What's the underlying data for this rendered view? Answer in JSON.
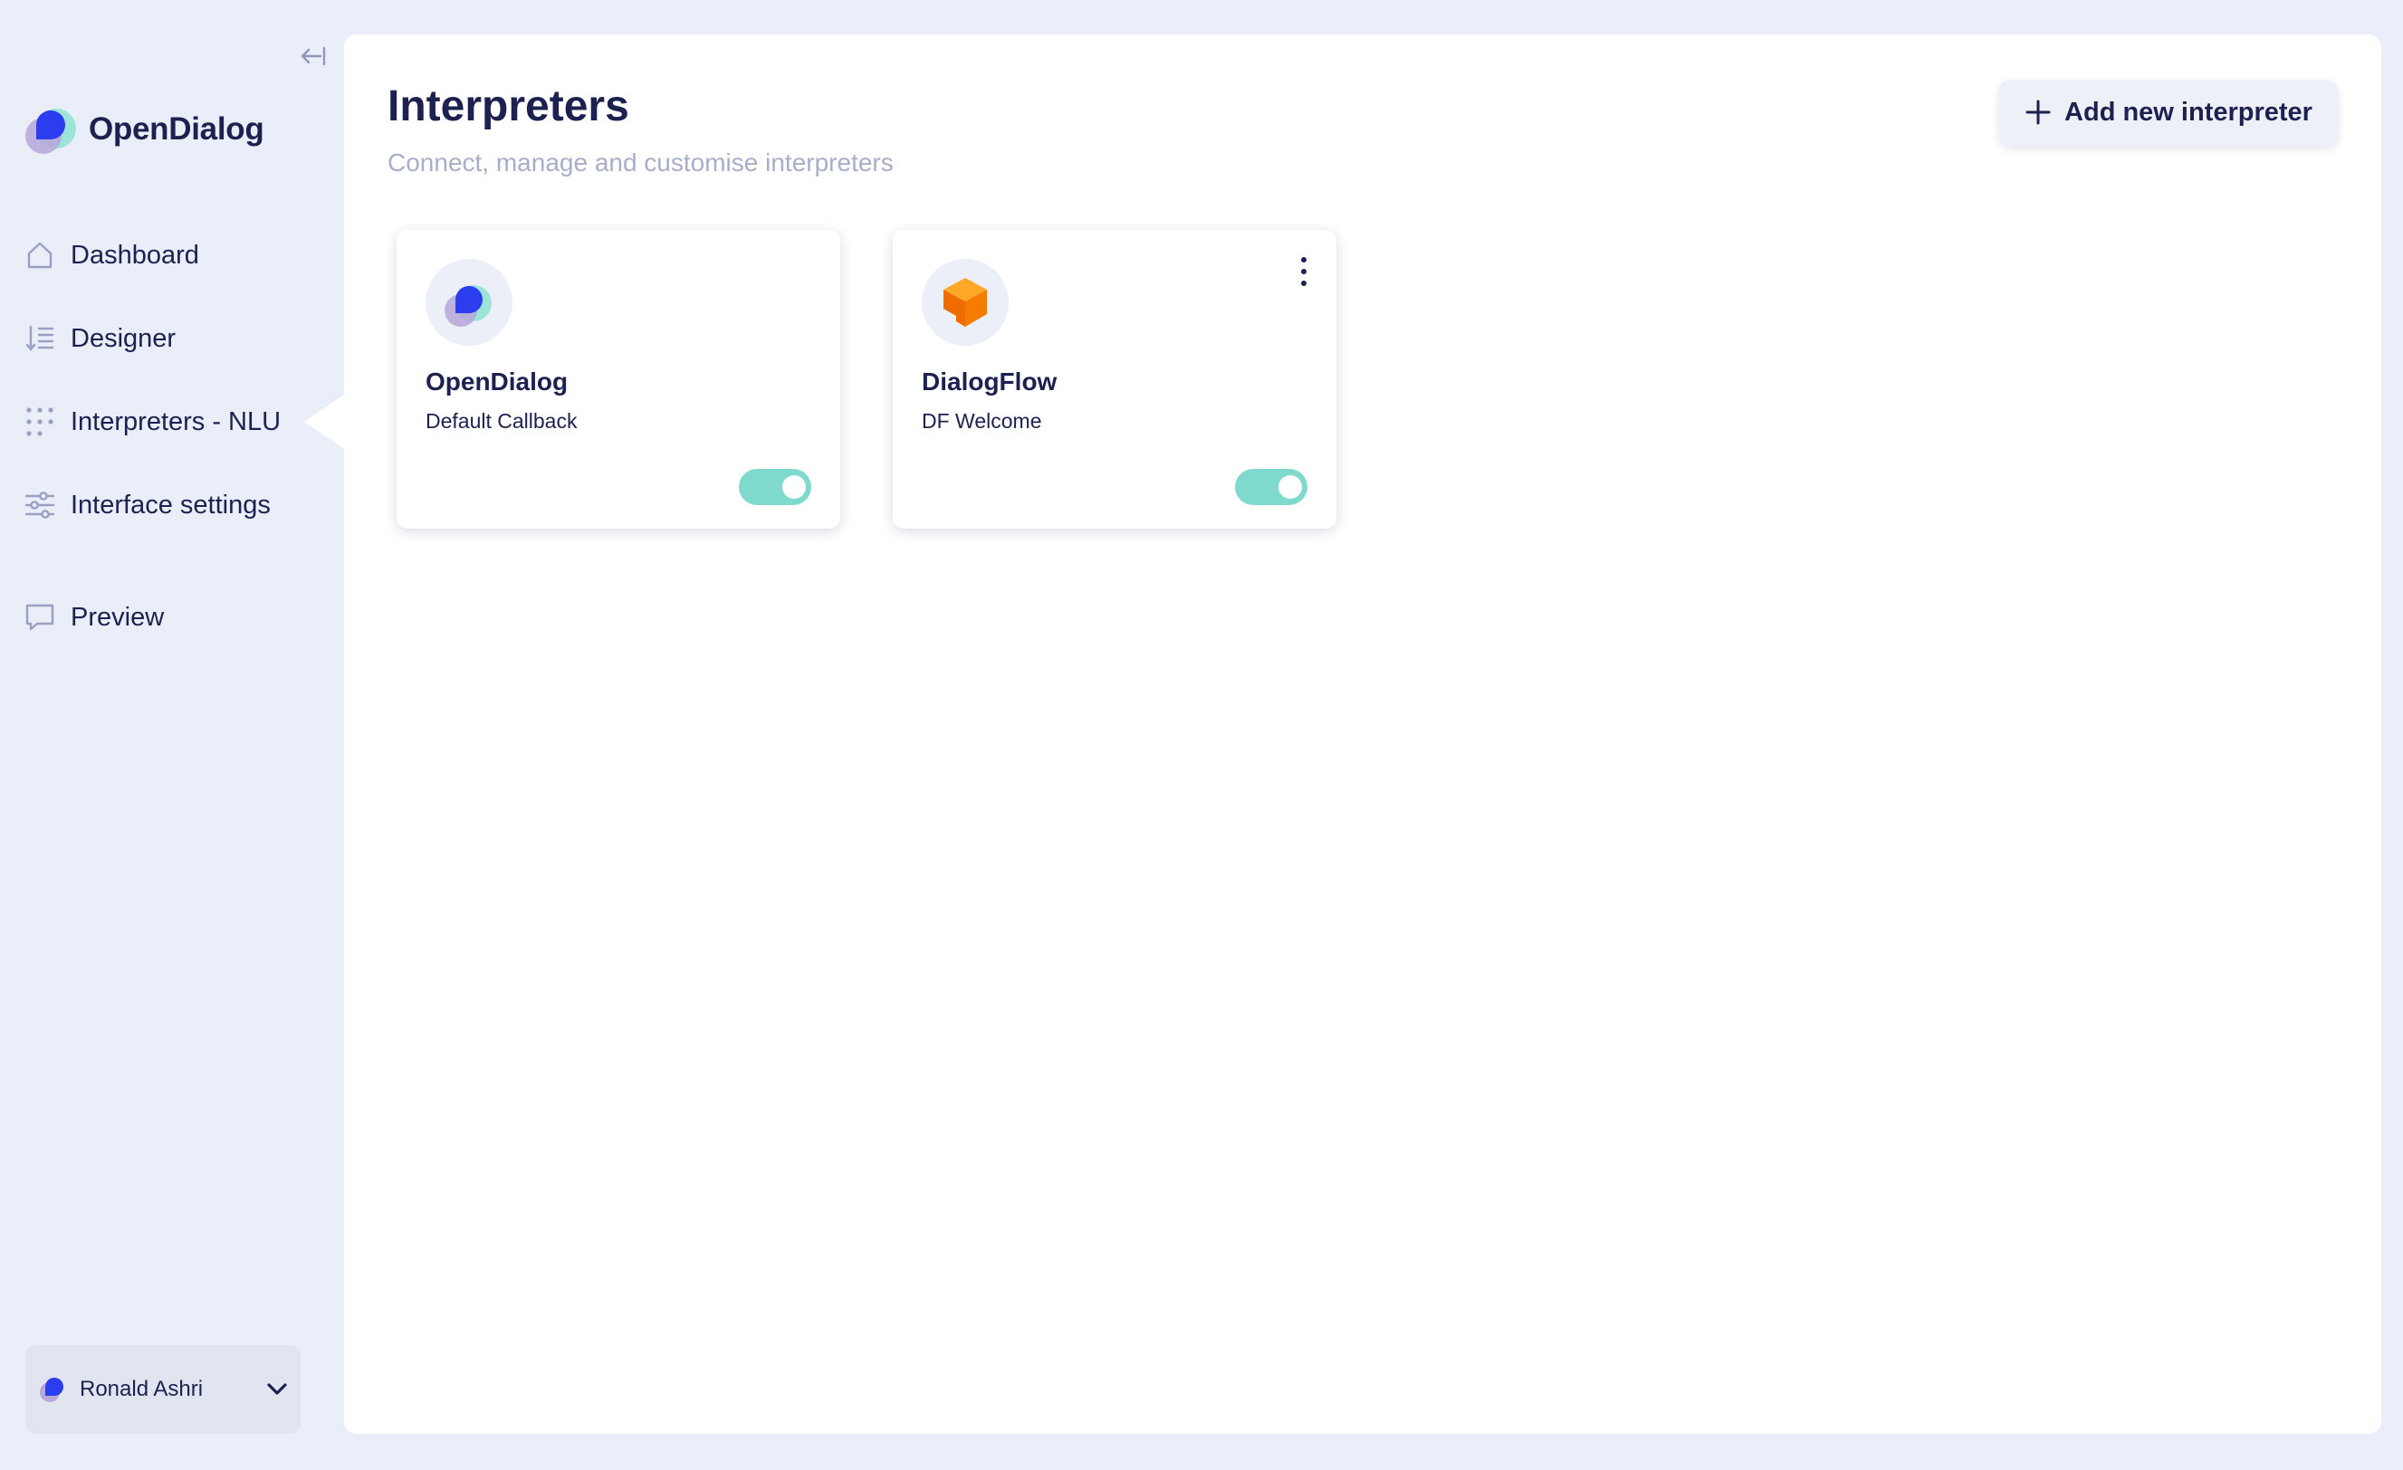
{
  "brand": {
    "name": "OpenDialog"
  },
  "sidebar": {
    "items": [
      {
        "label": "Dashboard",
        "icon": "home-icon"
      },
      {
        "label": "Designer",
        "icon": "list-sort-icon"
      },
      {
        "label": "Interpreters - NLU",
        "icon": "dots-grid-icon",
        "active": true
      },
      {
        "label": "Interface settings",
        "icon": "sliders-icon"
      },
      {
        "label": "Preview",
        "icon": "chat-bubble-icon"
      }
    ],
    "user": {
      "name": "Ronald Ashri"
    }
  },
  "main": {
    "title": "Interpreters",
    "subtitle": "Connect, manage and customise interpreters",
    "add_button_label": "Add new interpreter",
    "cards": [
      {
        "name": "OpenDialog",
        "sub": "Default Callback",
        "enabled": true,
        "icon": "opendialog-logo-icon"
      },
      {
        "name": "DialogFlow",
        "sub": "DF Welcome",
        "enabled": true,
        "icon": "dialogflow-logo-icon"
      }
    ]
  },
  "colors": {
    "background": "#eaeef8",
    "text": "#1c2150",
    "toggle_on": "#7fd9cc",
    "brand_blue": "#2c3df0",
    "dialogflow_orange": "#f57c00"
  }
}
